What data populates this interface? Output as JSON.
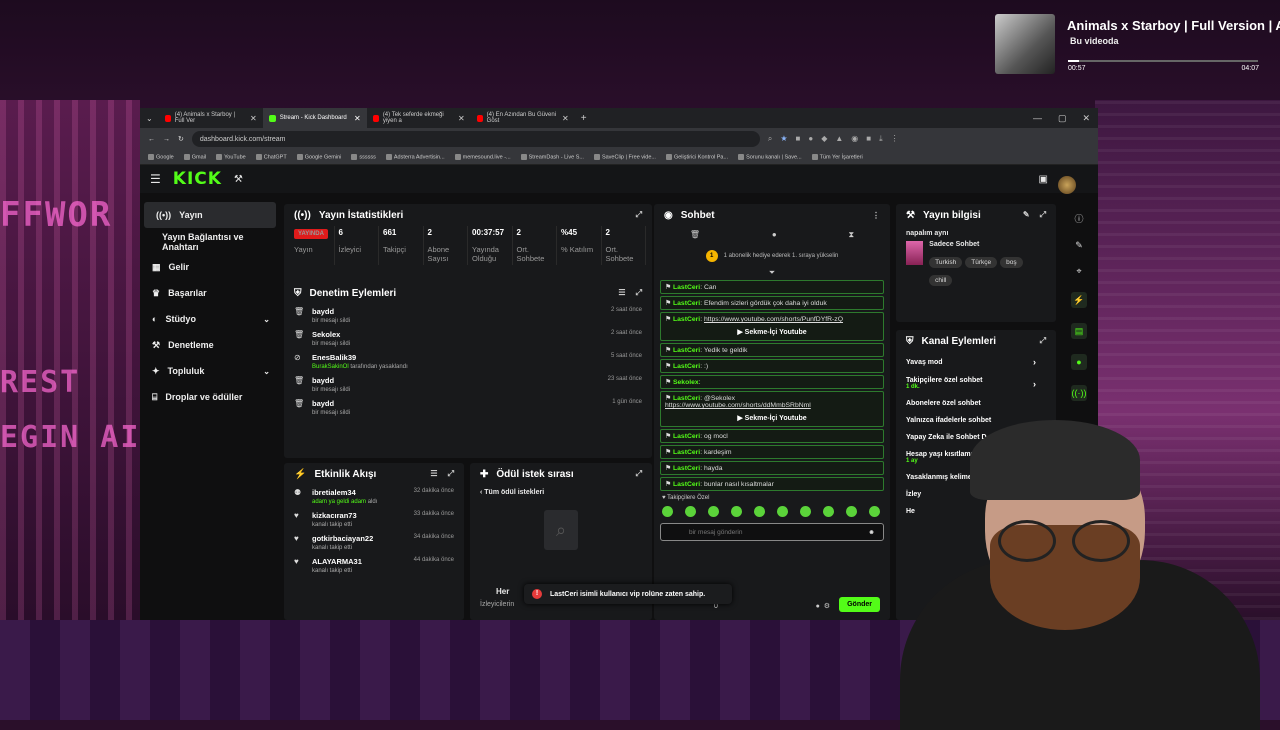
{
  "music": {
    "title": "Animals x Starboy | Full Version | A",
    "subtitle": "Bu videoda",
    "current_time": "00:57",
    "total_time": "04:07",
    "progress": 0.06
  },
  "background": {
    "text1": "FFWOR",
    "text2": "REST",
    "text3": "EGIN AI"
  },
  "browser": {
    "tabs": [
      {
        "label": "(4) Animals x Starboy | Full Ver",
        "active": false
      },
      {
        "label": "Stream - Kick Dashboard",
        "active": true
      },
      {
        "label": "(4) Tek seferde ekmeği yiyen a",
        "active": false
      },
      {
        "label": "(4) En Azından Bu Güveni Göst",
        "active": false
      }
    ],
    "url": "dashboard.kick.com/stream",
    "bookmarks": [
      "Google",
      "Gmail",
      "YouTube",
      "ChatGPT",
      "Google Gemini",
      "ssssss",
      "Adsterra Advertisin...",
      "memesound.live -...",
      "StreamDash - Live S...",
      "SaveClip | Free vide...",
      "Geliştirici Kontrol Pa...",
      "Sorunu kanalı | Save...",
      "Tüm Yer İşaretleri"
    ]
  },
  "kick": {
    "logo": "KICK",
    "sidebar": {
      "items": [
        {
          "label": "Yayın",
          "icon": "broadcast-icon"
        },
        {
          "label": "Yayın Bağlantısı ve Anahtarı"
        },
        {
          "label": "Gelir",
          "icon": "income-icon"
        },
        {
          "label": "Başarılar",
          "icon": "trophy-icon"
        },
        {
          "label": "Stüdyo",
          "icon": "studio-icon"
        },
        {
          "label": "Denetleme",
          "icon": "hammer-icon"
        },
        {
          "label": "Topluluk",
          "icon": "community-icon"
        },
        {
          "label": "Droplar ve ödüller",
          "icon": "gift-icon"
        }
      ]
    },
    "stats": {
      "title": "Yayın İstatistikleri",
      "live_badge": "YAYINDA",
      "items": [
        {
          "value": "",
          "label": "Yayın"
        },
        {
          "value": "6",
          "label": "İzleyici"
        },
        {
          "value": "661",
          "label": "Takipçi"
        },
        {
          "value": "2",
          "label": "Abone Sayısı"
        },
        {
          "value": "00:37:57",
          "label": "Yayında Olduğu"
        },
        {
          "value": "2",
          "label": "Ort. Sohbete"
        },
        {
          "value": "%45",
          "label": "% Katılım"
        },
        {
          "value": "2",
          "label": "Ort. Sohbete"
        }
      ]
    },
    "moderation": {
      "title": "Denetim Eylemleri",
      "rows": [
        {
          "name": "baydd",
          "desc": "bir mesajı sildi",
          "time": "2 saat önce"
        },
        {
          "name": "Sekolex",
          "desc": "bir mesajı sildi",
          "time": "2 saat önce"
        },
        {
          "name": "EnesBalik39",
          "desc_green": "BurakSakinOl",
          "desc": "tarafından yasaklandı",
          "time": "5 saat önce"
        },
        {
          "name": "baydd",
          "desc": "bir mesajı sildi",
          "time": "23 saat önce"
        },
        {
          "name": "baydd",
          "desc": "bir mesajı sildi",
          "time": "1 gün önce"
        }
      ]
    },
    "activity": {
      "title": "Etkinlik Akışı",
      "rows": [
        {
          "name": "ibretialem34",
          "desc_green": "adam ya geldi adam",
          "desc": "aldı",
          "time": "32 dakika önce"
        },
        {
          "name": "kizkacıran73",
          "desc": "kanalı takip etti",
          "time": "33 dakika önce"
        },
        {
          "name": "gotkirbaciayan22",
          "desc": "kanalı takip etti",
          "time": "34 dakika önce"
        },
        {
          "name": "ALAYARMA31",
          "desc": "kanalı takip etti",
          "time": "44 dakika önce"
        }
      ]
    },
    "rewards": {
      "title": "Ödül istek sırası",
      "back_label": "Tüm ödül istekleri",
      "empty_title": "Her",
      "empty_sub": "İzleyicilerin"
    },
    "chat": {
      "title": "Sohbet",
      "gift_banner": "1 abonelik hediye ederek 1. sıraya yükselin",
      "messages": [
        {
          "user": "LastCeri",
          "text": "Can"
        },
        {
          "user": "LastCeri",
          "text": "Efendim sizleri gördük çok daha iyi olduk"
        },
        {
          "user": "LastCeri",
          "text": "https://www.youtube.com/shorts/PunfDYfR-zQ",
          "link": true,
          "embed": "Sekme-İçi Youtube"
        },
        {
          "user": "LastCeri",
          "text": "Yedik te geldik"
        },
        {
          "user": "LastCeri",
          "text": ":)"
        },
        {
          "user": "Sekolex",
          "text": ""
        },
        {
          "user": "LastCeri",
          "text": "@Sekolex",
          "text2": "https://www.youtube.com/shorts/ddMmbSRbNml",
          "embed": "Sekme-İçi Youtube"
        },
        {
          "user": "LastCeri",
          "text": "og mocl"
        },
        {
          "user": "LastCeri",
          "text": "kardeşim"
        },
        {
          "user": "LastCeri",
          "text": "hayda"
        },
        {
          "user": "LastCeri",
          "text": "bunlar nasıl kısaltmalar"
        }
      ],
      "followers_only": "Takipçilere Özel",
      "input_placeholder": "bir mesaj gönderin",
      "send_label": "Gönder",
      "counter": "0"
    },
    "toast": "LastCeri isimli kullanıcı vip rolüne zaten sahip.",
    "stream_info": {
      "title": "Yayın bilgisi",
      "stream_title": "napalım aynı",
      "category": "Sadece Sohbet",
      "tags": [
        "Turkish",
        "Türkçe",
        "boş",
        "chill"
      ]
    },
    "channel_actions": {
      "title": "Kanal Eylemleri",
      "items": [
        {
          "label": "Yavaş mod",
          "sub": ""
        },
        {
          "label": "Takipçilere özel sohbet",
          "sub": "1 dk."
        },
        {
          "label": "Abonelere özel sohbet",
          "sub": ""
        },
        {
          "label": "Yalnızca ifadelerle sohbet",
          "sub": ""
        },
        {
          "label": "Yapay Zeka ile Sohbet D",
          "sub": ""
        },
        {
          "label": "Hesap yaşı kısıtlaması",
          "sub": "1 ay"
        },
        {
          "label": "Yasaklanmış kelimeler",
          "sub": ""
        },
        {
          "label": "İzley",
          "sub": ""
        },
        {
          "label": "He",
          "sub": ""
        }
      ]
    }
  },
  "colors": {
    "accent": "#53fc18",
    "live": "#e01b1b",
    "panel": "#18191b",
    "bg": "#0f0f10"
  }
}
